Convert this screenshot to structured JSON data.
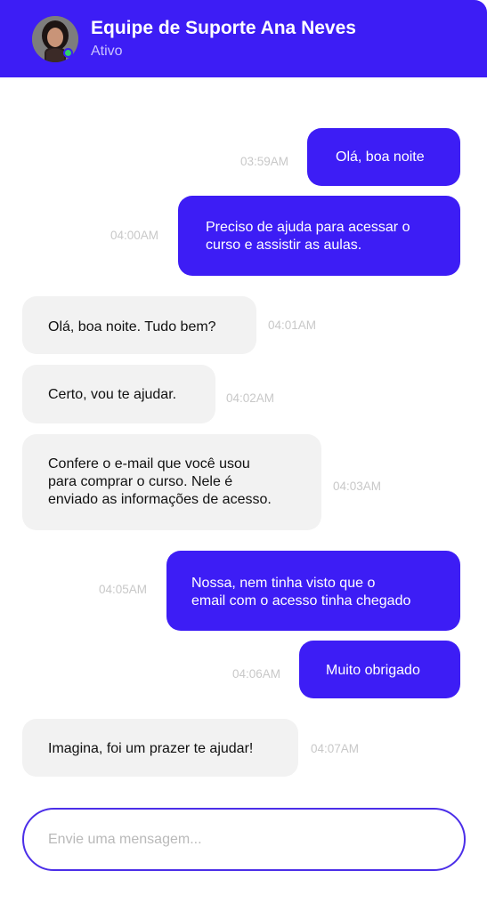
{
  "header": {
    "title": "Equipe de Suporte Ana Neves",
    "status": "Ativo"
  },
  "messages": [
    {
      "direction": "out",
      "text": "Olá, boa noite",
      "time": "03:59AM"
    },
    {
      "direction": "out",
      "text": "Preciso de ajuda para acessar o\ncurso e assistir as aulas.",
      "time": "04:00AM"
    },
    {
      "direction": "in",
      "text": "Olá, boa noite. Tudo bem?",
      "time": "04:01AM"
    },
    {
      "direction": "in",
      "text": "Certo, vou te ajudar.",
      "time": "04:02AM"
    },
    {
      "direction": "in",
      "text": "Confere o e-mail que você usou\npara comprar o curso. Nele é\nenviado as informações de acesso.",
      "time": "04:03AM"
    },
    {
      "direction": "out",
      "text": "Nossa, nem tinha visto que o\nemail com o acesso tinha chegado",
      "time": "04:05AM"
    },
    {
      "direction": "out",
      "text": "Muito obrigado",
      "time": "04:06AM"
    },
    {
      "direction": "in",
      "text": "Imagina, foi um prazer te ajudar!",
      "time": "04:07AM"
    }
  ],
  "composer": {
    "placeholder": "Envie uma mensagem...",
    "value": ""
  },
  "colors": {
    "accent": "#3d1df5",
    "incoming_bubble": "#f2f2f2",
    "online": "#2fd16a"
  }
}
